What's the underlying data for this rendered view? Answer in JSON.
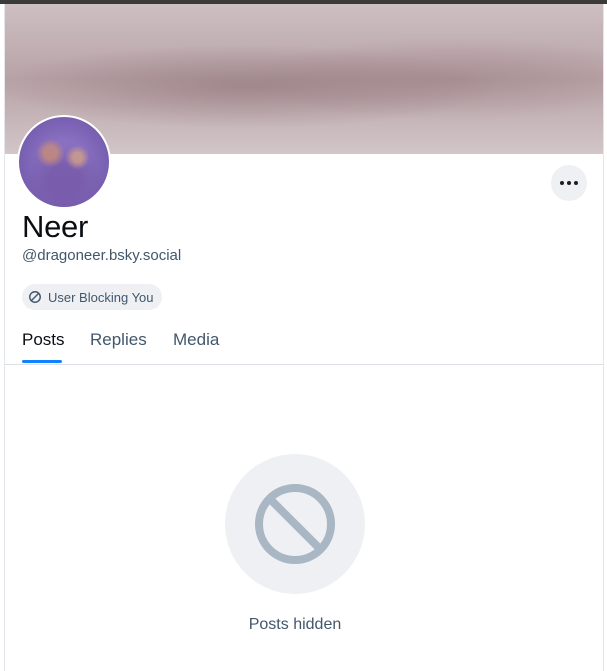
{
  "profile": {
    "display_name": "Neer",
    "handle": "@dragoneer.bsky.social",
    "badge_label": "User Blocking You",
    "banner_icon": "blurred-banner-image",
    "avatar_icon": "blurred-avatar-image",
    "more_icon": "ellipsis-icon"
  },
  "tabs": [
    {
      "label": "Posts",
      "active": true
    },
    {
      "label": "Replies",
      "active": false
    },
    {
      "label": "Media",
      "active": false
    }
  ],
  "empty_state": {
    "message": "Posts hidden",
    "icon": "prohibited-icon"
  },
  "colors": {
    "accent": "#1083fe",
    "muted_text": "#42576c",
    "chip_bg": "#eef0f3"
  }
}
